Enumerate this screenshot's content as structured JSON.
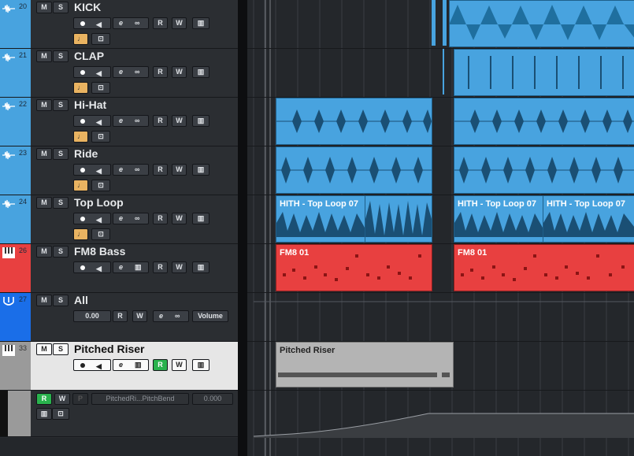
{
  "tracks": [
    {
      "number": "20",
      "name": "KICK",
      "type": "audio",
      "color": "#48a3df"
    },
    {
      "number": "21",
      "name": "CLAP",
      "type": "audio",
      "color": "#48a3df"
    },
    {
      "number": "22",
      "name": "Hi-Hat",
      "type": "audio",
      "color": "#48a3df"
    },
    {
      "number": "23",
      "name": "Ride",
      "type": "audio",
      "color": "#48a3df"
    },
    {
      "number": "24",
      "name": "Top Loop",
      "type": "audio",
      "color": "#48a3df"
    },
    {
      "number": "26",
      "name": "FM8 Bass",
      "type": "instrument",
      "color": "#e84040"
    },
    {
      "number": "27",
      "name": "All",
      "type": "group",
      "color": "#1a6ee8",
      "volume_value": "0.00",
      "volume_label": "Volume"
    },
    {
      "number": "33",
      "name": "Pitched Riser",
      "type": "instrument",
      "color": "#9a9a9a",
      "selected": true
    }
  ],
  "button_labels": {
    "mute": "M",
    "solo": "S",
    "read": "R",
    "write": "W",
    "edit": "e",
    "lock": "P"
  },
  "automation": {
    "parameter": "PitchedRi...PitchBend",
    "value": "0.000"
  },
  "clips": {
    "top_loop_1": "HITH - Top Loop 07",
    "top_loop_2": "HITH - Top Loop 07",
    "top_loop_3": "HITH - Top Loop 07",
    "fm8_1": "FM8 01",
    "fm8_2": "FM8 01",
    "riser": "Pitched Riser"
  },
  "colors": {
    "audio_clip": "#48a3df",
    "midi_clip": "#e84040",
    "riser_clip": "#b4b4b4",
    "record_green": "#29b24d",
    "monitor_orange": "#e9b361"
  }
}
